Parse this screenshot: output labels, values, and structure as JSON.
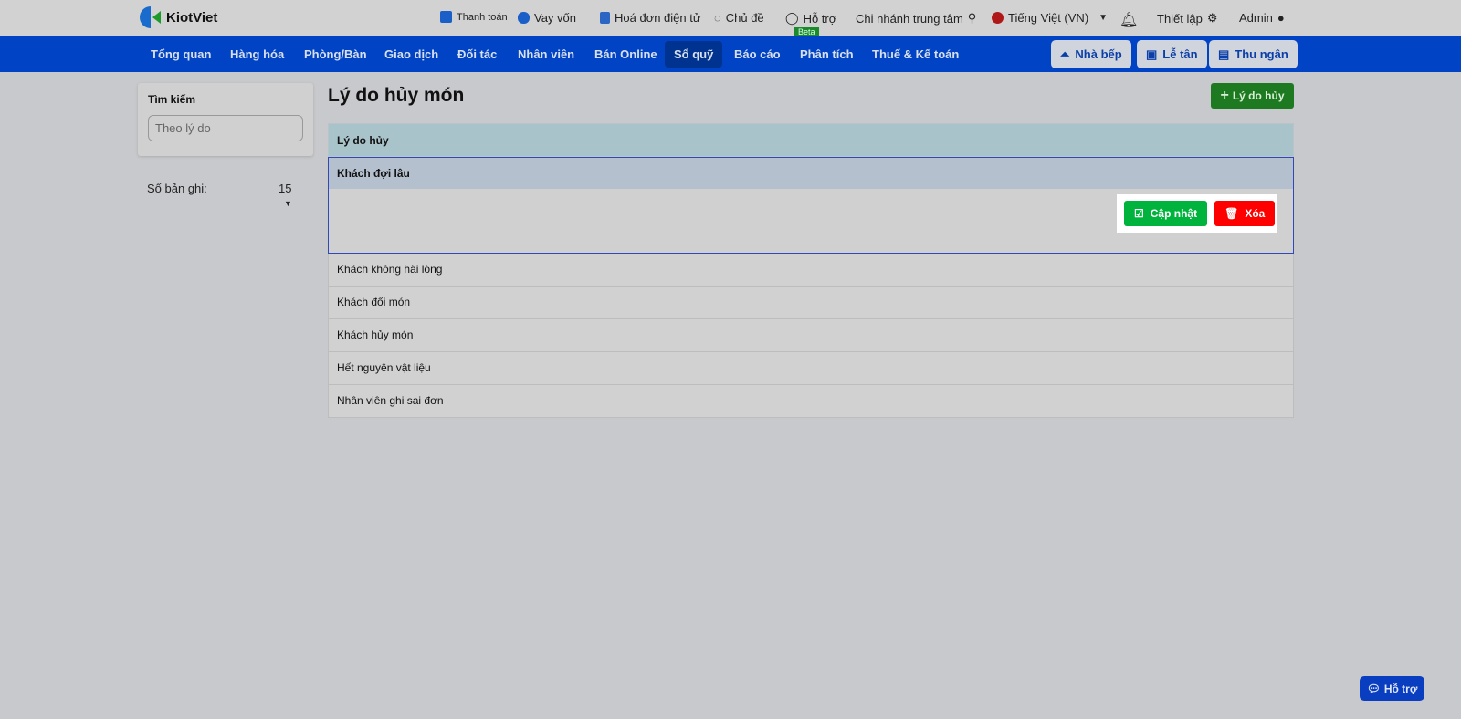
{
  "brand": "KiotViet",
  "topbar": {
    "payment": "Thanh toán",
    "loan": "Vay vốn",
    "einvoice": "Hoá đơn điện tử",
    "theme": "Chủ đề",
    "support": "Hỗ trợ",
    "beta": "Beta",
    "branch": "Chi nhánh trung tâm",
    "language": "Tiếng Việt (VN)",
    "settings": "Thiết lập",
    "user": "Admin"
  },
  "nav": {
    "items": [
      "Tổng quan",
      "Hàng hóa",
      "Phòng/Bàn",
      "Giao dịch",
      "Đối tác",
      "Nhân viên",
      "Bán Online",
      "Sổ quỹ",
      "Báo cáo",
      "Phân tích",
      "Thuế & Kế toán"
    ],
    "active": "Sổ quỹ",
    "kitchen": "Nhà bếp",
    "reception": "Lễ tân",
    "cashier": "Thu ngân"
  },
  "sidebar": {
    "search_title": "Tìm kiếm",
    "search_placeholder": "Theo lý do",
    "records_label": "Số bản ghi:",
    "records_value": "15"
  },
  "main": {
    "title": "Lý do hủy món",
    "add_button": "Lý do hủy",
    "column": "Lý do hủy",
    "selected": "Khách đợi lâu",
    "update": "Cập nhật",
    "delete": "Xóa",
    "rows": [
      "Khách không hài lòng",
      "Khách đổi món",
      "Khách hủy món",
      "Hết nguyên vật liệu",
      "Nhân viên ghi sai đơn"
    ]
  },
  "help_button": "Hỗ trợ"
}
